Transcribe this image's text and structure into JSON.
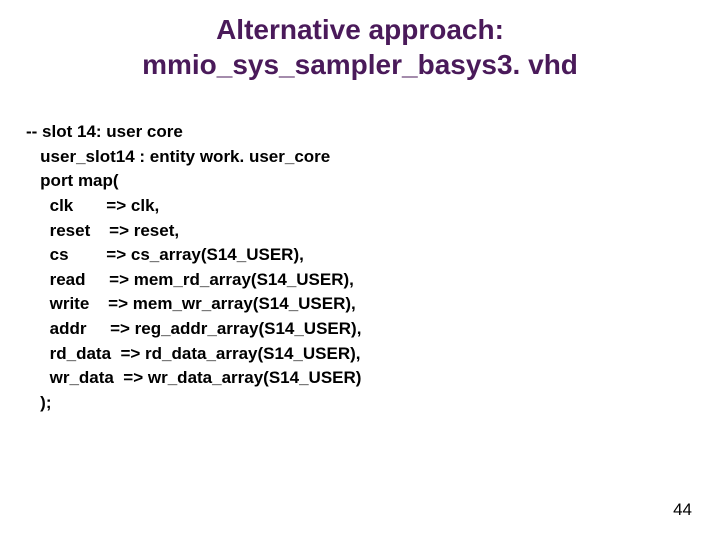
{
  "title": {
    "line1": "Alternative approach:",
    "line2": "mmio_sys_sampler_basys3. vhd"
  },
  "code": {
    "l0": "-- slot 14: user core",
    "l1": "   user_slot14 : entity work. user_core",
    "l2": "   port map(",
    "l3": "     clk       => clk,",
    "l4": "     reset    => reset,",
    "l5": "     cs        => cs_array(S14_USER),",
    "l6": "     read     => mem_rd_array(S14_USER),",
    "l7": "     write    => mem_wr_array(S14_USER),",
    "l8": "     addr     => reg_addr_array(S14_USER),",
    "l9": "     rd_data  => rd_data_array(S14_USER),",
    "l10": "     wr_data  => wr_data_array(S14_USER)",
    "l11": "   );"
  },
  "page_number": "44"
}
